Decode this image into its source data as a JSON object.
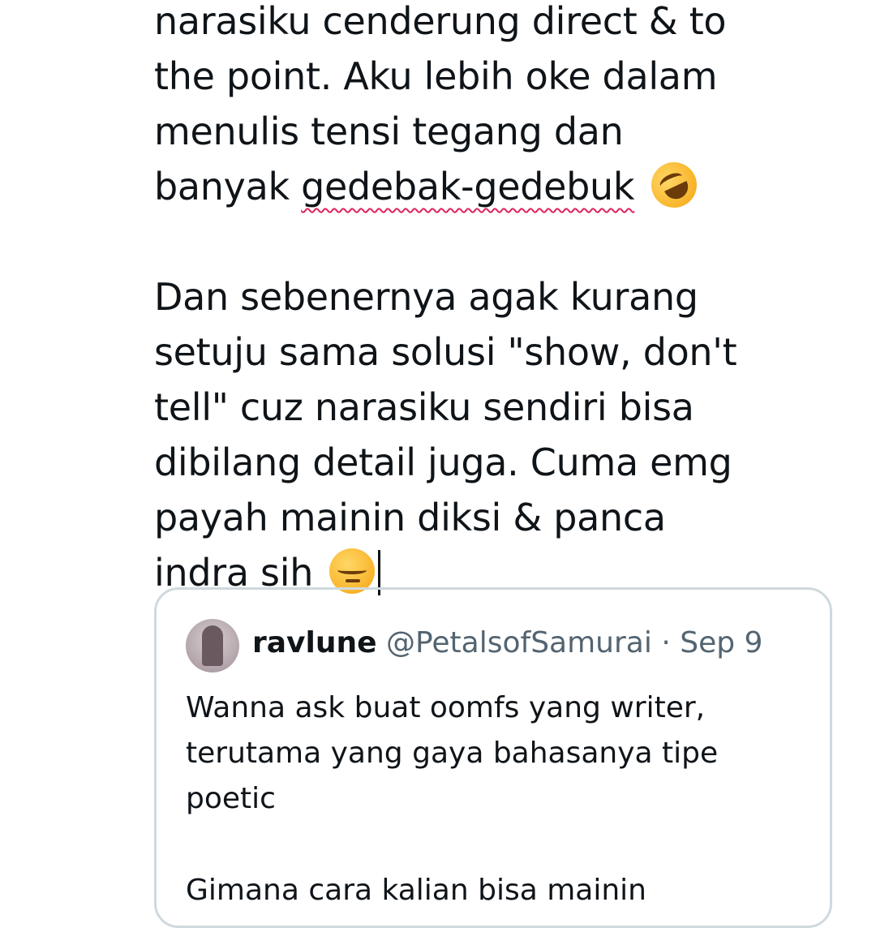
{
  "compose": {
    "lines": [
      "narasiku cenderung direct & to",
      "the point. Aku lebih oke dalam",
      "menulis tensi tegang dan",
      "banyak ",
      "gedebak-gedebuk",
      "Dan sebenernya agak kurang",
      "setuju sama solusi \"show, don't",
      "tell\" cuz narasiku sendiri bisa",
      "dibilang detail juga. Cuma emg",
      "payah mainin diksi & panca",
      "indra sih"
    ],
    "emoji_1": "rofl-emoji",
    "emoji_2": "pensive-emoji"
  },
  "quote": {
    "name": "ravlune",
    "handle": "@PetalsofSamurai",
    "separator": "·",
    "date": "Sep 9",
    "body": [
      "Wanna ask buat oomfs yang writer,",
      "terutama yang gaya bahasanya tipe",
      "poetic"
    ],
    "partial_line": "Gimana cara kalian bisa mainin"
  },
  "colors": {
    "text": "#0f1419",
    "secondary": "#536471",
    "border": "#cfd9de",
    "spellcheck": "#e0245e"
  }
}
